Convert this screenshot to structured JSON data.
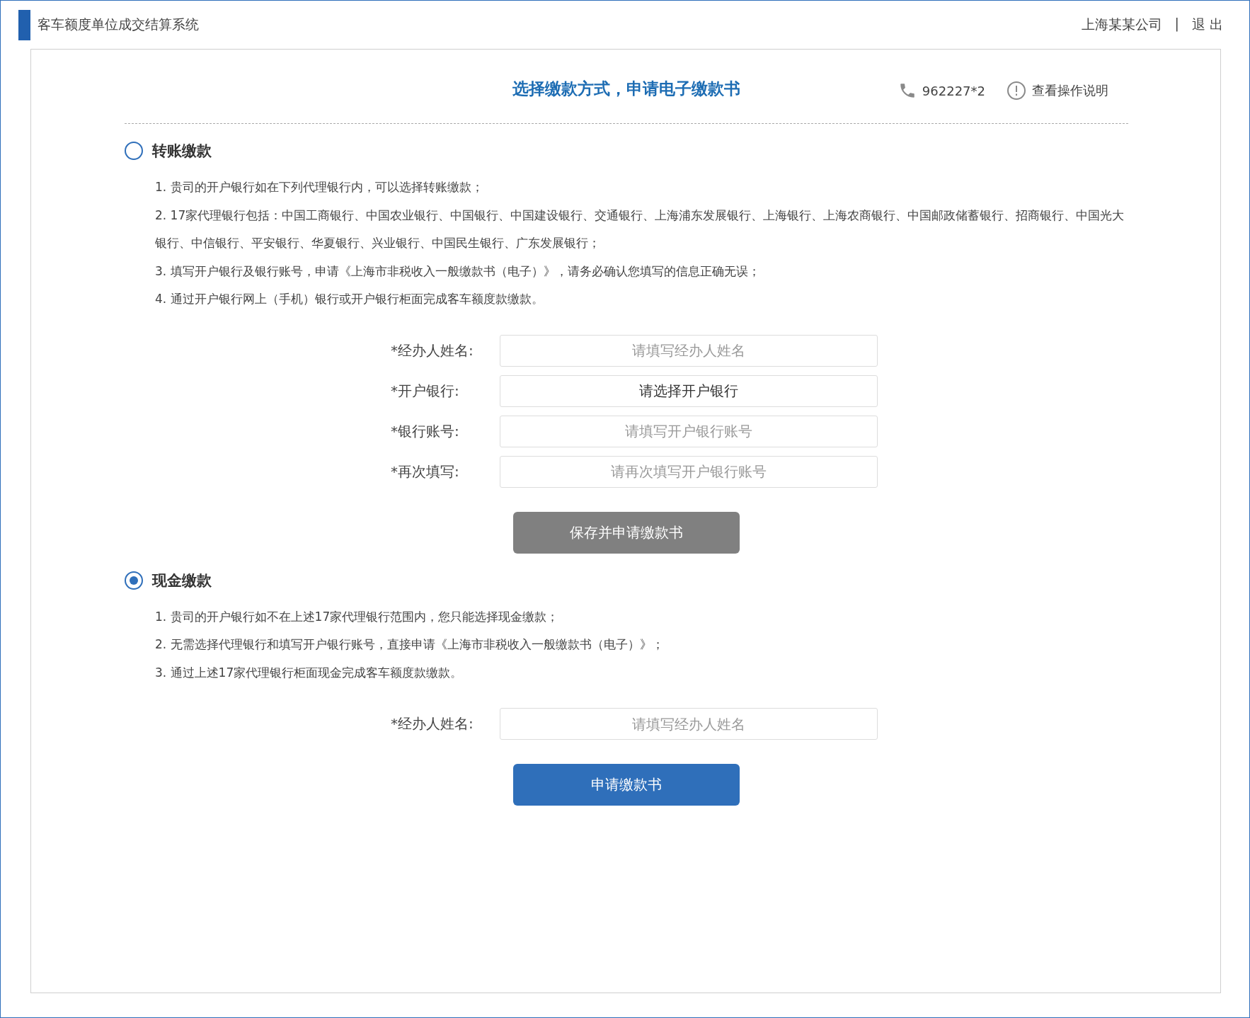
{
  "header": {
    "title": "客车额度单位成交结算系统",
    "company": "上海某某公司",
    "separator": "|",
    "logout": "退 出"
  },
  "panel": {
    "title": "选择缴款方式，申请电子缴款书",
    "phone": "962227*2",
    "help": "查看操作说明"
  },
  "sections": [
    {
      "title": "转账缴款",
      "selected": false,
      "notes": [
        "1. 贵司的开户银行如在下列代理银行内，可以选择转账缴款；",
        "2. 17家代理银行包括：中国工商银行、中国农业银行、中国银行、中国建设银行、交通银行、上海浦东发展银行、上海银行、上海农商银行、中国邮政储蓄银行、招商银行、中国光大银行、中信银行、平安银行、华夏银行、兴业银行、中国民生银行、广东发展银行；",
        "3. 填写开户银行及银行账号，申请《上海市非税收入一般缴款书（电子）》，请务必确认您填写的信息正确无误；",
        "4. 通过开户银行网上（手机）银行或开户银行柜面完成客车额度款缴款。"
      ],
      "fields": [
        {
          "label": "*经办人姓名:",
          "kind": "input",
          "placeholder": "请填写经办人姓名"
        },
        {
          "label": "*开户银行:",
          "kind": "select",
          "value": "请选择开户银行"
        },
        {
          "label": "*银行账号:",
          "kind": "input",
          "placeholder": "请填写开户银行账号"
        },
        {
          "label": "*再次填写:",
          "kind": "input",
          "placeholder": "请再次填写开户银行账号"
        }
      ],
      "button": {
        "label": "保存并申请缴款书",
        "disabled": true
      }
    },
    {
      "title": "现金缴款",
      "selected": true,
      "notes": [
        "1. 贵司的开户银行如不在上述17家代理银行范围内，您只能选择现金缴款；",
        "2. 无需选择代理银行和填写开户银行账号，直接申请《上海市非税收入一般缴款书（电子）》；",
        "3. 通过上述17家代理银行柜面现金完成客车额度款缴款。"
      ],
      "fields": [
        {
          "label": "*经办人姓名:",
          "kind": "input",
          "placeholder": "请填写经办人姓名"
        }
      ],
      "button": {
        "label": "申请缴款书",
        "disabled": false
      }
    }
  ]
}
